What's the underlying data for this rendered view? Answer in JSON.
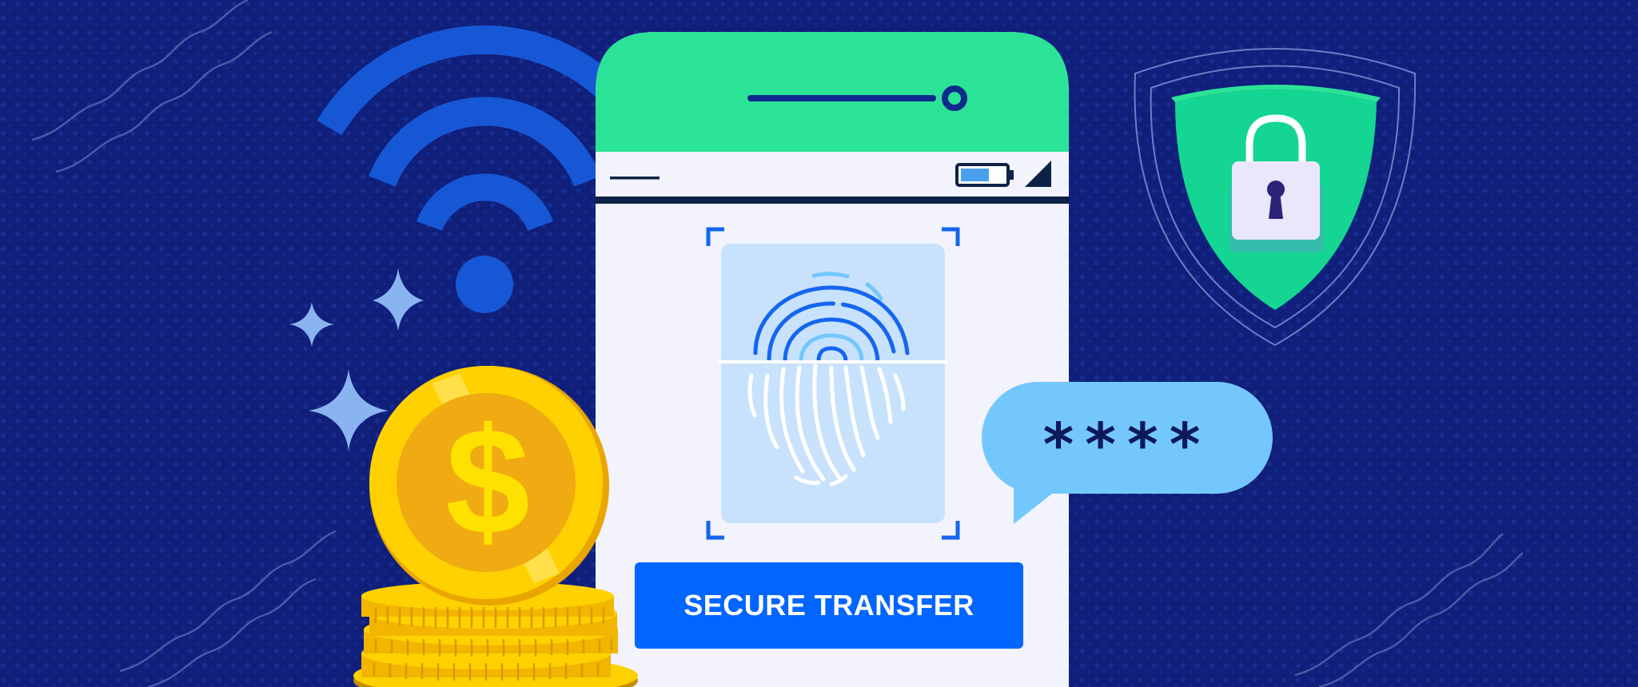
{
  "action_button": {
    "label": "SECURE TRANSFER"
  },
  "password_bubble": {
    "text": "****"
  },
  "icons": [
    "wifi-icon",
    "sparkle-icon",
    "coin-dollar-icon",
    "coin-stack-icon",
    "fingerprint-icon",
    "battery-icon",
    "signal-icon",
    "shield-lock-icon",
    "speech-bubble-icon"
  ],
  "colors": {
    "background": "#0f1f7a",
    "phone_header": "#2be397",
    "phone_screen": "#f2f3fd",
    "accent_blue": "#0066ff",
    "shield_green": "#14d692",
    "coin_gold": "#ffc400",
    "bubble_blue": "#74c7fc"
  }
}
